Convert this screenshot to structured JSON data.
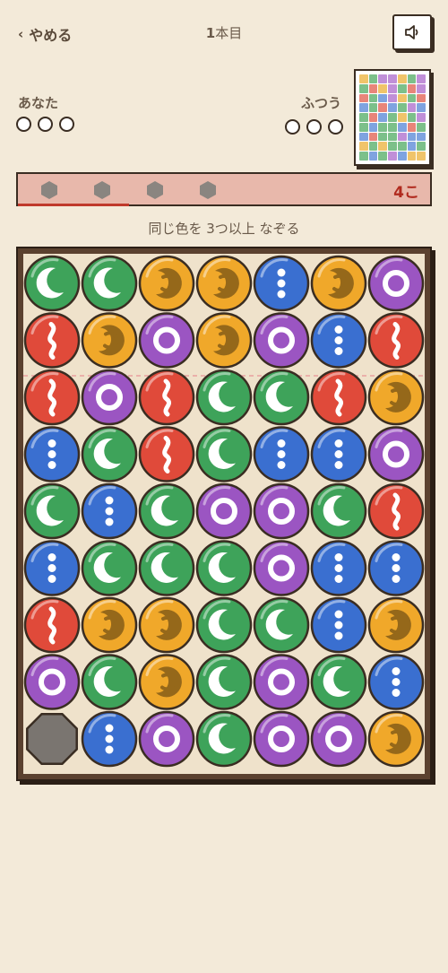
{
  "header": {
    "quit_label": "やめる",
    "round_number": "1",
    "round_suffix": "本目"
  },
  "icons": {
    "back": "chevron-left-icon",
    "sound": "speaker-icon"
  },
  "players": {
    "you": {
      "name": "あなた",
      "lives": 3
    },
    "opponent": {
      "name": "ふつう",
      "lives": 3
    }
  },
  "progress": {
    "count_label": "4こ",
    "markers": 4,
    "fill_fraction": 0.27
  },
  "hint": "同じ色を 3つ以上 なぞる",
  "colors": {
    "green": "#3ea35a",
    "red": "#e04a3a",
    "yellow": "#f0a82a",
    "purple": "#9b55c2",
    "blue": "#3a6fd0",
    "stone": "#7a7570"
  },
  "board": {
    "cols": 7,
    "rows": 9,
    "cells": [
      [
        "green",
        "green",
        "yellow",
        "yellow",
        "blue",
        "yellow",
        "purple"
      ],
      [
        "red",
        "yellow",
        "purple",
        "yellow",
        "purple",
        "blue",
        "red"
      ],
      [
        "red",
        "purple",
        "red",
        "green",
        "green",
        "red",
        "yellow"
      ],
      [
        "blue",
        "green",
        "red",
        "green",
        "blue",
        "blue",
        "purple"
      ],
      [
        "green",
        "blue",
        "green",
        "purple",
        "purple",
        "green",
        "red"
      ],
      [
        "blue",
        "green",
        "green",
        "green",
        "purple",
        "blue",
        "blue"
      ],
      [
        "red",
        "yellow",
        "yellow",
        "green",
        "green",
        "blue",
        "yellow"
      ],
      [
        "purple",
        "green",
        "yellow",
        "green",
        "purple",
        "green",
        "blue"
      ],
      [
        "stone",
        "blue",
        "purple",
        "green",
        "purple",
        "purple",
        "yellow"
      ]
    ]
  },
  "preview": {
    "cells": [
      [
        "yellow",
        "green",
        "purple",
        "purple",
        "yellow",
        "green",
        "purple"
      ],
      [
        "green",
        "red",
        "yellow",
        "purple",
        "green",
        "red",
        "purple"
      ],
      [
        "red",
        "green",
        "blue",
        "purple",
        "yellow",
        "green",
        "red"
      ],
      [
        "blue",
        "green",
        "red",
        "blue",
        "green",
        "purple",
        "blue"
      ],
      [
        "green",
        "red",
        "blue",
        "green",
        "yellow",
        "green",
        "purple"
      ],
      [
        "green",
        "blue",
        "green",
        "green",
        "blue",
        "red",
        "green"
      ],
      [
        "blue",
        "red",
        "green",
        "green",
        "purple",
        "blue",
        "blue"
      ],
      [
        "yellow",
        "green",
        "yellow",
        "green",
        "green",
        "blue",
        "green"
      ],
      [
        "green",
        "blue",
        "green",
        "purple",
        "blue",
        "yellow",
        "yellow"
      ]
    ]
  }
}
